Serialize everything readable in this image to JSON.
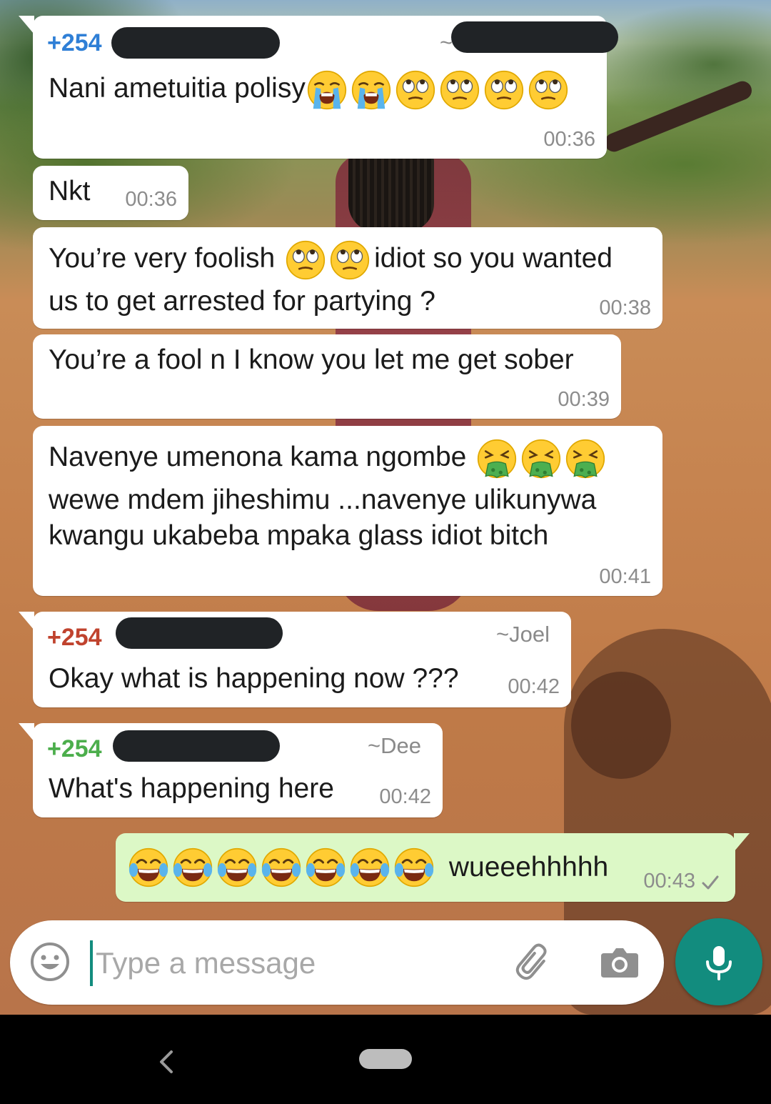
{
  "chat": {
    "messages": [
      {
        "sender": "+254",
        "sender_color": "#2f7fd6",
        "text": "Nani ametuitia polisy",
        "emojis": [
          "loudly-crying-face",
          "loudly-crying-face",
          "face-with-rolling-eyes",
          "face-with-rolling-eyes",
          "face-with-rolling-eyes",
          "face-with-rolling-eyes"
        ],
        "time": "00:36"
      },
      {
        "text": "Nkt",
        "time": "00:36"
      },
      {
        "text_before": "You’re very foolish",
        "emojis": [
          "face-with-rolling-eyes",
          "face-with-rolling-eyes"
        ],
        "text_after": "idiot so you wanted",
        "line2": "us to get arrested for partying ?",
        "time": "00:38"
      },
      {
        "text": "You’re a fool n I know you let me get sober",
        "time": "00:39"
      },
      {
        "text_before": "Navenye umenona kama ngombe",
        "emojis": [
          "face-vomiting",
          "face-vomiting",
          "face-vomiting"
        ],
        "line2": "wewe mdem jiheshimu ...navenye ulikunywa",
        "line3": "kwangu ukabeba mpaka glass idiot bitch",
        "time": "00:41"
      },
      {
        "sender": "+254",
        "sender_color": "#c0432e",
        "alias": "~Joel",
        "text": "Okay what is happening now ???",
        "time": "00:42"
      },
      {
        "sender": "+254",
        "sender_color": "#4cae4c",
        "alias": "~Dee",
        "text": "What's happening here",
        "time": "00:42"
      },
      {
        "outgoing": true,
        "emojis": [
          "face-with-tears-of-joy",
          "face-with-tears-of-joy",
          "face-with-tears-of-joy",
          "face-with-tears-of-joy",
          "face-with-tears-of-joy",
          "face-with-tears-of-joy",
          "face-with-tears-of-joy"
        ],
        "text": "wueeehhhhh",
        "time": "00:43",
        "status_icon": "single-check-icon"
      }
    ]
  },
  "composer": {
    "placeholder": "Type a message",
    "value": "",
    "emoji_icon": "smiley-icon",
    "attach_icon": "paperclip-icon",
    "camera_icon": "camera-icon",
    "mic_icon": "microphone-icon"
  },
  "navigation": {
    "back_icon": "back-chevron-icon",
    "home_icon": "home-pill-icon"
  },
  "colors": {
    "incoming_bubble": "#ffffff",
    "outgoing_bubble": "#dcf8c6",
    "accent": "#128c7e"
  }
}
